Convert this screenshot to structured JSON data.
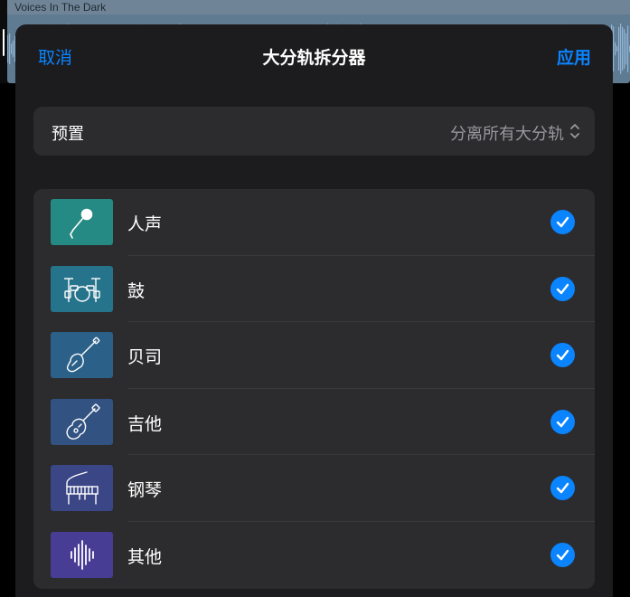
{
  "background": {
    "region_title": "Voices In The Dark"
  },
  "dialog": {
    "cancel_label": "取消",
    "title": "大分轨拆分器",
    "apply_label": "应用"
  },
  "preset": {
    "label": "预置",
    "value": "分离所有大分轨"
  },
  "stems": [
    {
      "name": "人声",
      "icon": "microphone-icon",
      "color": "#248a83",
      "checked": true
    },
    {
      "name": "鼓",
      "icon": "drum-kit-icon",
      "color": "#26748c",
      "checked": true
    },
    {
      "name": "贝司",
      "icon": "bass-guitar-icon",
      "color": "#2b6189",
      "checked": true
    },
    {
      "name": "吉他",
      "icon": "electric-guitar-icon",
      "color": "#325282",
      "checked": true
    },
    {
      "name": "钢琴",
      "icon": "piano-icon",
      "color": "#3a4686",
      "checked": true
    },
    {
      "name": "其他",
      "icon": "waveform-icon",
      "color": "#473d95",
      "checked": true
    }
  ],
  "colors": {
    "accent": "#0a84ff",
    "sheet_bg": "#1c1c1e",
    "cell_bg": "#2c2c2e"
  }
}
